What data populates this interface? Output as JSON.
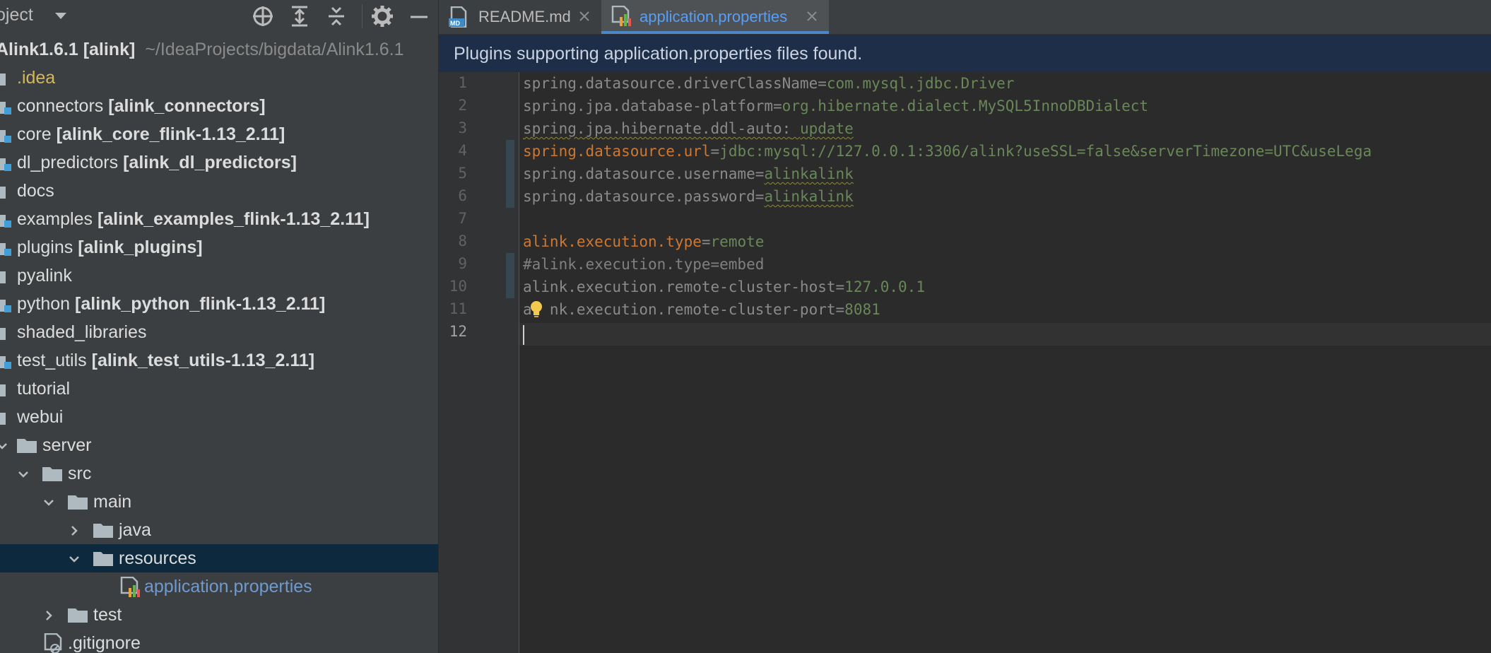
{
  "project_panel": {
    "title": "oject",
    "toolbar_icons": [
      "locate-icon",
      "expand-all-icon",
      "collapse-all-icon",
      "gear-icon",
      "minimize-icon"
    ],
    "tree": [
      {
        "name": "Alink1.6.1",
        "module": "[alink]",
        "hint": "~/IdeaProjects/bigdata/Alink1.6.1"
      },
      {
        "name": ".idea"
      },
      {
        "name": "connectors",
        "module": "[alink_connectors]"
      },
      {
        "name": "core",
        "module": "[alink_core_flink-1.13_2.11]"
      },
      {
        "name": "dl_predictors",
        "module": "[alink_dl_predictors]"
      },
      {
        "name": "docs"
      },
      {
        "name": "examples",
        "module": "[alink_examples_flink-1.13_2.11]"
      },
      {
        "name": "plugins",
        "module": "[alink_plugins]"
      },
      {
        "name": "pyalink"
      },
      {
        "name": "python",
        "module": "[alink_python_flink-1.13_2.11]"
      },
      {
        "name": "shaded_libraries"
      },
      {
        "name": "test_utils",
        "module": "[alink_test_utils-1.13_2.11]"
      },
      {
        "name": "tutorial"
      },
      {
        "name": "webui"
      },
      {
        "name": "server"
      },
      {
        "name": "src"
      },
      {
        "name": "main"
      },
      {
        "name": "java"
      },
      {
        "name": "resources"
      },
      {
        "name": "application.properties"
      },
      {
        "name": "test"
      },
      {
        "name": ".gitignore"
      }
    ]
  },
  "tabs": [
    {
      "label": "README.md",
      "icon": "markdown-file-icon",
      "badge": "MD"
    },
    {
      "label": "application.properties",
      "icon": "properties-file-icon",
      "active": true
    }
  ],
  "banner": {
    "text": "Plugins supporting application.properties files found."
  },
  "editor": {
    "line_numbers": [
      "1",
      "2",
      "3",
      "4",
      "5",
      "6",
      "7",
      "8",
      "9",
      "10",
      "11",
      "12"
    ],
    "lines": [
      {
        "key": "spring.datasource.driverClassName",
        "eq": "=",
        "val": "com.mysql.jdbc.Driver"
      },
      {
        "key": "spring.jpa.database-platform",
        "eq": "=",
        "val": "org.hibernate.dialect.MySQL5InnoDBDialect"
      },
      {
        "key": "spring.jpa.hibernate.ddl-auto:",
        "eq": " ",
        "val": "update"
      },
      {
        "key": "spring.datasource.url",
        "eq": "=",
        "val": "jdbc:mysql://127.0.0.1:3306/alink?useSSL=false&serverTimezone=UTC&useLega"
      },
      {
        "key": "spring.datasource.username",
        "eq": "=",
        "val": "alinkalink"
      },
      {
        "key": "spring.datasource.password",
        "eq": "=",
        "val": "alinkalink"
      },
      {
        "comment": ""
      },
      {
        "key": "alink.execution.type",
        "eq": "=",
        "val": "remote"
      },
      {
        "comment": "#alink.execution.type=embed"
      },
      {
        "key": "alink.execution.remote-cluster-host",
        "eq": "=",
        "val": "127.0.0.1"
      },
      {
        "key": "a  nk.execution.remote-cluster-port",
        "eq": "=",
        "val": "8081"
      }
    ]
  },
  "colors": {
    "accent": "#4a88c7",
    "selection": "#0d293e",
    "keyword": "#cc7832",
    "string": "#6a8759"
  }
}
